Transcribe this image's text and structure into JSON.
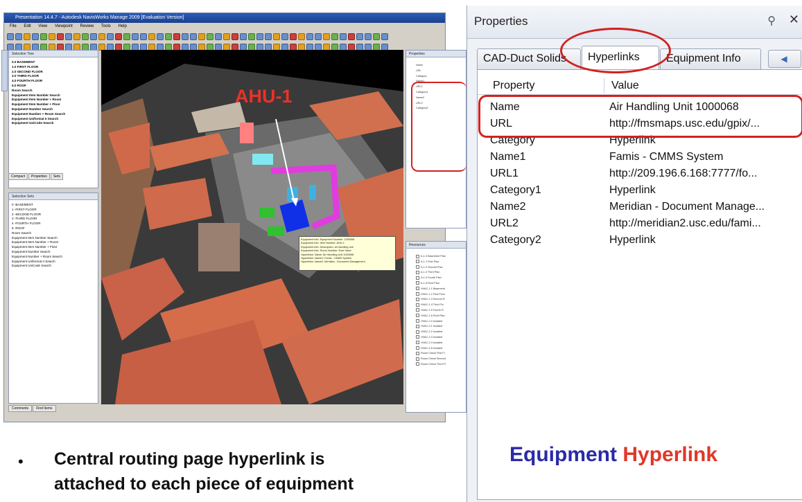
{
  "app": {
    "title": "Presentation 14.4.7 - Autodesk NavisWorks Manage 2009 [Evaluation Version]",
    "menu": [
      "File",
      "Edit",
      "View",
      "Viewpoint",
      "Review",
      "Tools",
      "Help"
    ],
    "selection_tree": {
      "title": "Selection Tree",
      "items": [
        "0.0 BASEMENT",
        "1.0 FIRST FLOOR",
        "2.0 SECOND FLOOR",
        "3.0 THIRD FLOOR",
        "4.0 FOURTH FLOOR",
        "5.0 ROOF",
        "Room Search",
        "Equipment Item Number Search",
        "Equipment Item Number + Room",
        "Equipment Item Number + Floor",
        "Equipment Number Search",
        "Equipment Number + Room Search",
        "Equipment Uniformat II Search",
        "Equipment UniCode Search"
      ]
    },
    "left_tabs": [
      "Compact",
      "Properties",
      "Sets"
    ],
    "selection_sets": {
      "title": "Selection Sets",
      "items": [
        "0 -BASEMENT",
        "1 -FIRST FLOOR",
        "2 -SECOND FLOOR",
        "3 -THIRD FLOOR",
        "4 -FOURTH FLOOR",
        "5 -ROOF",
        "Room Search",
        "Equipment Item Number Search",
        "Equipment Item Number + Room",
        "Equipment Item Number + Floor",
        "Equipment Number Search",
        "Equipment Number + Room Search",
        "Equipment Uniformat II Search",
        "Equipment UniCode Search"
      ]
    },
    "bottom_tabs": [
      "Comments",
      "Find Items"
    ],
    "ahu_label": "AHU-1",
    "tooltip_lines": [
      "Equipment Info: Equipment Number: 1000068",
      "Equipment Info: Item Number: AHU-1",
      "Equipment Info: Description: air handling unit",
      "Equipment Info: Room Number: Roof Valve",
      "Hyperlinks: Name: Air Handling Unit 1000068",
      "Hyperlinks: Name1: Famis - CMMS System",
      "Hyperlinks: Name2: Meridian - Document Management"
    ],
    "props_small_title": "Properties",
    "props_small_rows": [
      "Name",
      "URL",
      "Category",
      "Name1",
      "URL1",
      "Category1",
      "Name2",
      "URL2",
      "Category2"
    ],
    "resources_title": "Resources",
    "resources_items": [
      "A-1.0 Basement Plan",
      "A-1.1 First Plan",
      "A-1.2 Second Plan",
      "A-1.3 Third Plan",
      "A-1.4 Fourth Plan",
      "A-1.5 Roof Plan",
      "HVAC-1.1 Basement",
      "HVAC-1.2 First Floor",
      "HVAC-1.3 Second Fl",
      "HVAC-1.4 Third Flo",
      "HVAC-1.5 Fourth Fl",
      "HVAC-1.6 Roof Plan",
      "HVAC-2.0 Isolated",
      "HVAC-2.1 Isolated",
      "HVAC-2.2 Isolated",
      "HVAC-2.3 Isolated",
      "HVAC-2.4 Isolated",
      "HVAC-2.5 Isolated",
      "Room Check First Fl",
      "Room Check Second",
      "Room Check Third Fl"
    ]
  },
  "properties": {
    "title": "Properties",
    "tabs": [
      "CAD-Duct Solids",
      "Hyperlinks",
      "Equipment Info"
    ],
    "nav": "◀ ▶",
    "columns": [
      "Property",
      "Value"
    ],
    "rows": [
      {
        "k": "Name",
        "v": "Air Handling Unit 1000068"
      },
      {
        "k": "URL",
        "v": "http://fmsmaps.usc.edu/gpix/..."
      },
      {
        "k": "Category",
        "v": "Hyperlink"
      },
      {
        "k": "Name1",
        "v": "Famis - CMMS System"
      },
      {
        "k": "URL1",
        "v": "http://209.196.6.168:7777/fo..."
      },
      {
        "k": "Category1",
        "v": "Hyperlink"
      },
      {
        "k": "Name2",
        "v": "Meridian - Document Manage..."
      },
      {
        "k": "URL2",
        "v": "http://meridian2.usc.edu/fami..."
      },
      {
        "k": "Category2",
        "v": "Hyperlink"
      }
    ]
  },
  "caption": {
    "bullet": "•",
    "line1": "Central routing page hyperlink is",
    "line2": "attached to each piece of equipment"
  },
  "equipment_caption": {
    "word1": "Equipment",
    "word2": "Hyperlink"
  },
  "colors": {
    "annotation_red": "#d32020",
    "blue": "#2a2aa8",
    "red": "#e03828"
  }
}
